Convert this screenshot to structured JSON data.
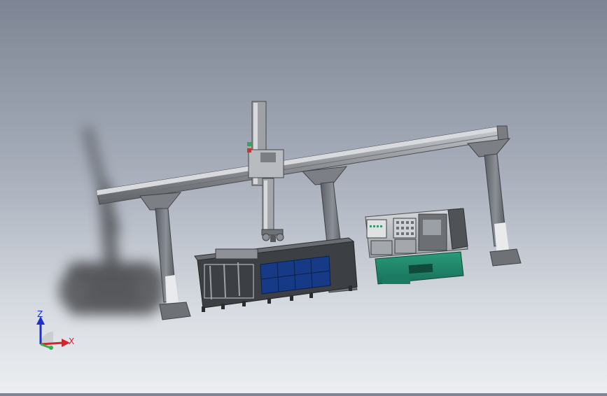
{
  "viewport": {
    "background_top": "#7d8493",
    "background_bottom": "#eceef1"
  },
  "axis_triad": {
    "z_label": "Z",
    "x_label": "X",
    "z_color": "#1e2fd0",
    "x_color": "#d4232a",
    "y_color": "#2bb34a"
  },
  "model": {
    "frame_color": "#8c9096",
    "cabinet_color": "#1f8a6e",
    "conveyor_panel_color": "#173a86",
    "sensor_color": "#2aa06a"
  }
}
